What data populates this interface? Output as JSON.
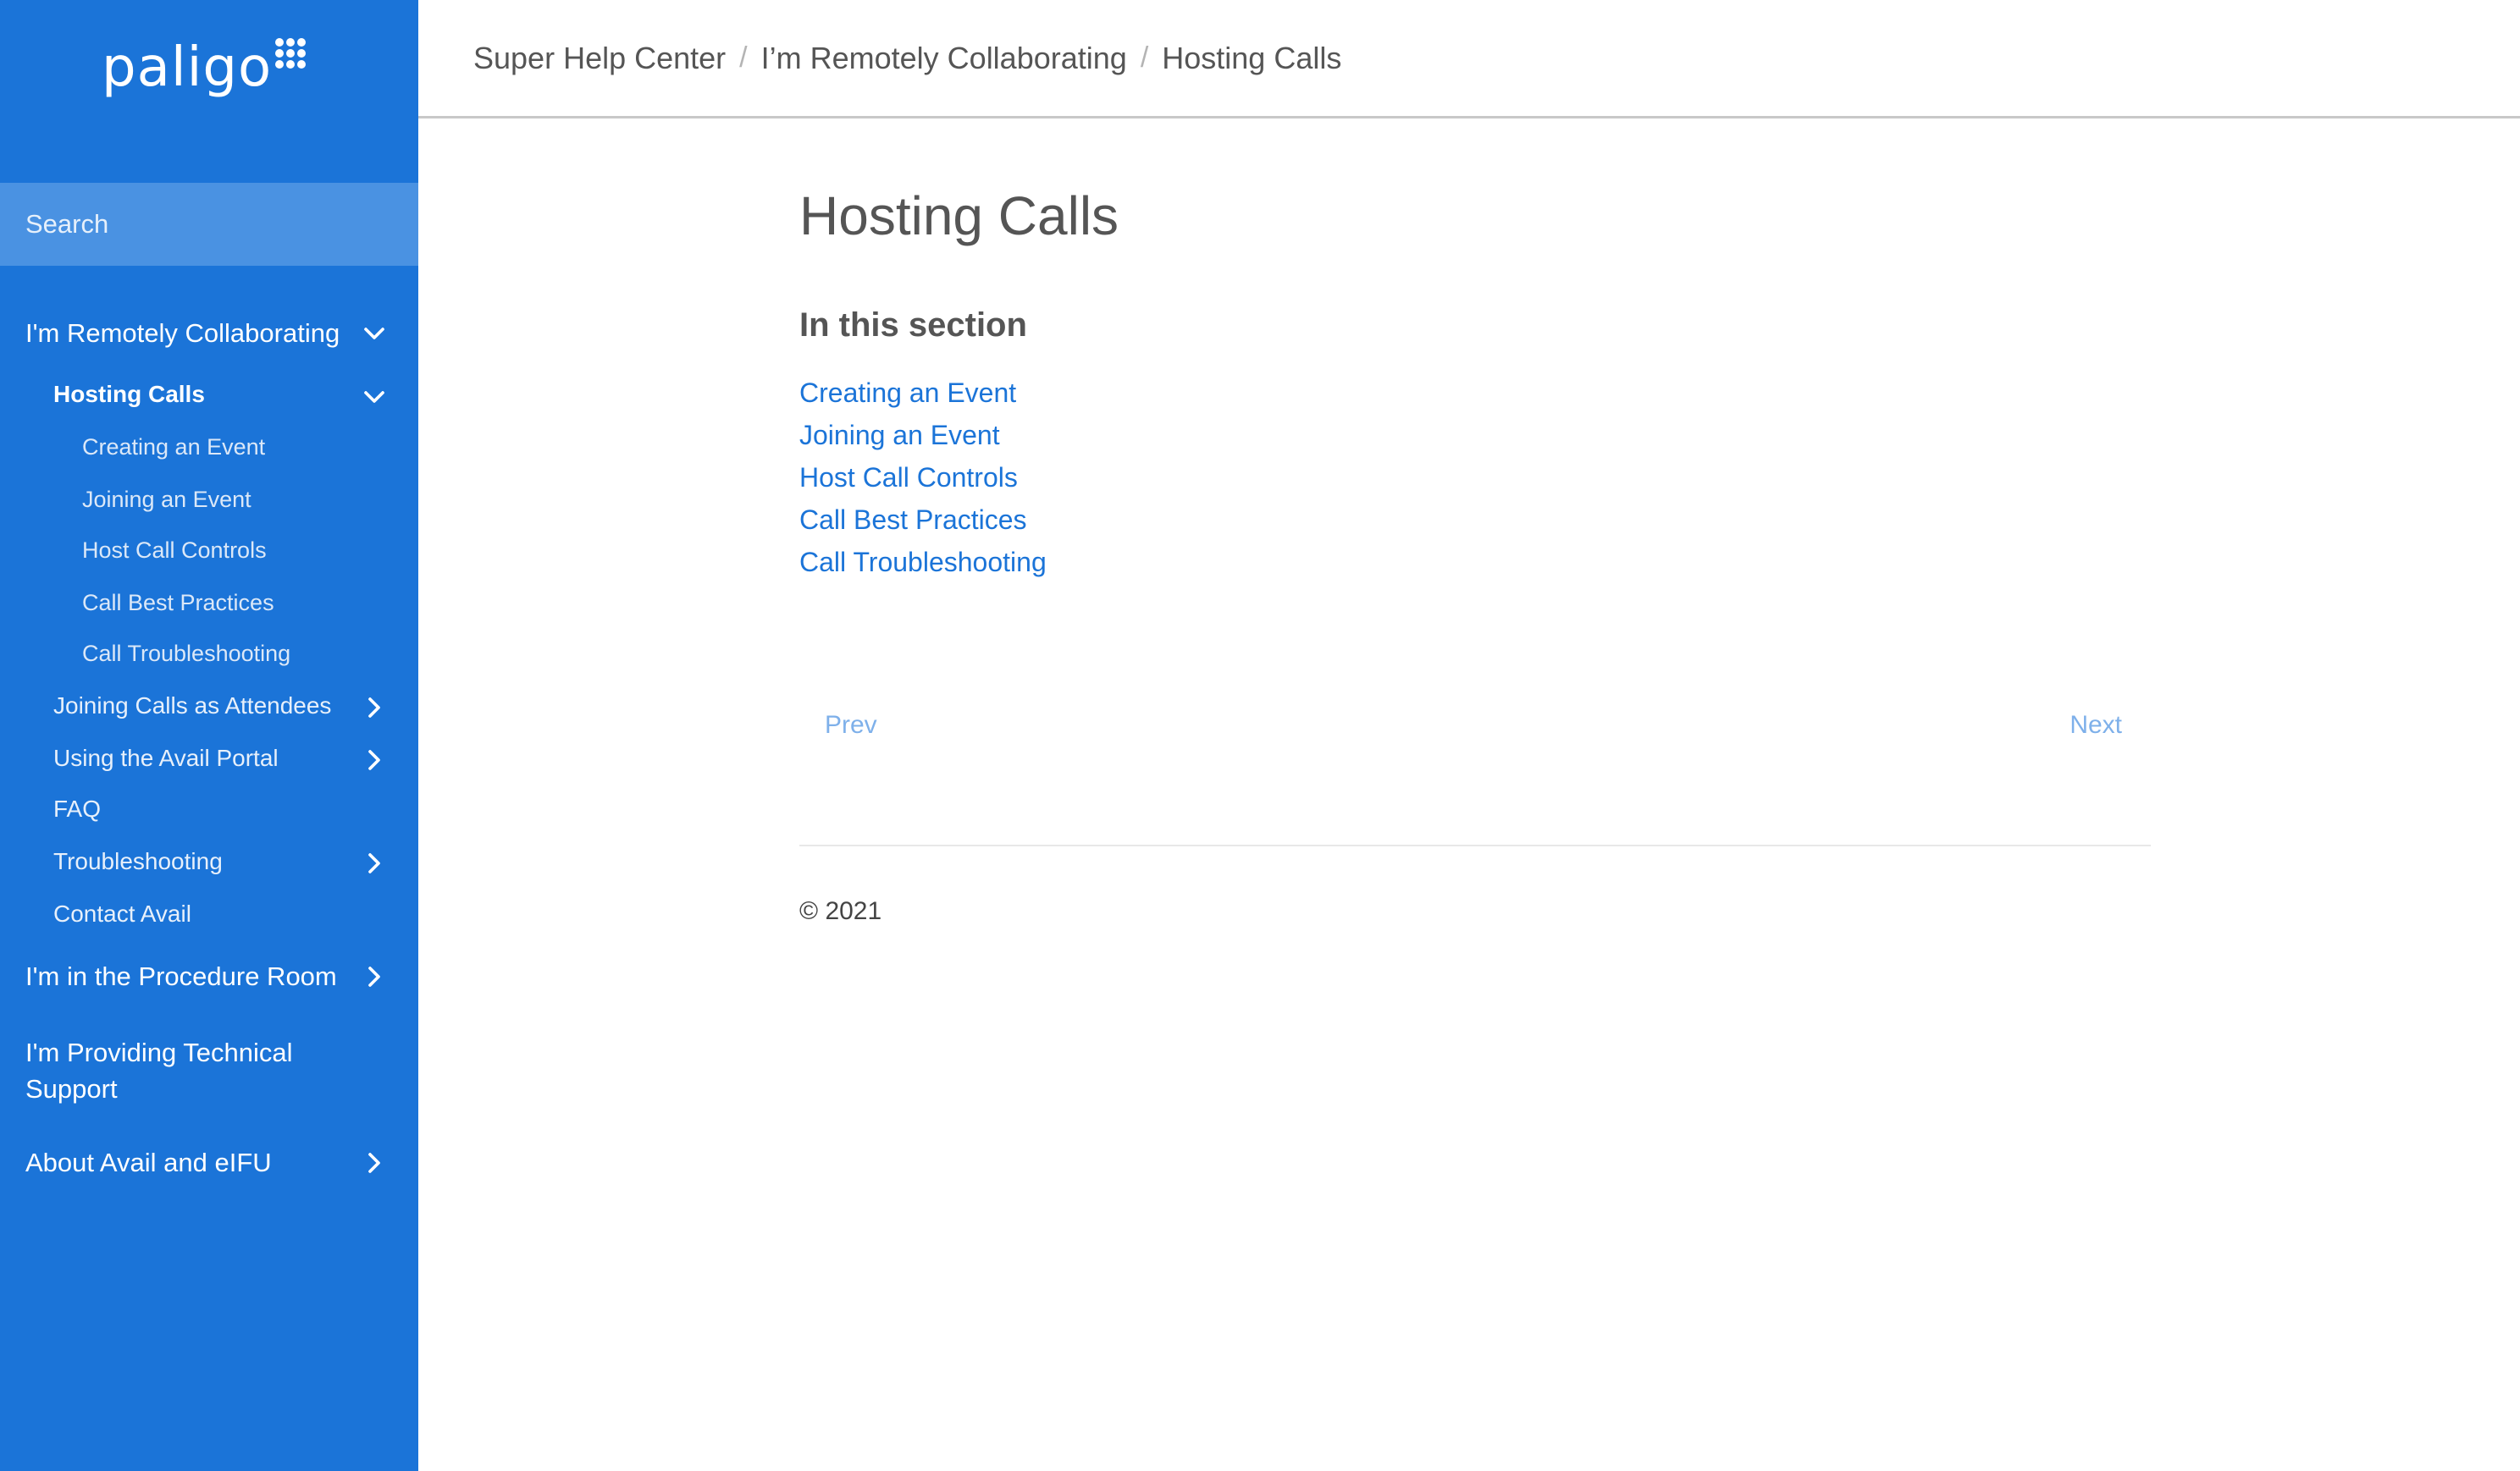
{
  "logo": {
    "text": "paligo"
  },
  "search": {
    "placeholder": "Search"
  },
  "sidebar": {
    "items": [
      {
        "label": "I'm Remotely Collaborating",
        "chevron": "chevron-down"
      },
      {
        "label": "Hosting Calls",
        "chevron": "chevron-down"
      },
      {
        "label": "Creating an Event"
      },
      {
        "label": "Joining an Event"
      },
      {
        "label": "Host Call Controls"
      },
      {
        "label": "Call Best Practices"
      },
      {
        "label": "Call Troubleshooting"
      },
      {
        "label": "Joining Calls as Attendees",
        "chevron": "chevron-right"
      },
      {
        "label": "Using the Avail Portal",
        "chevron": "chevron-right"
      },
      {
        "label": "FAQ"
      },
      {
        "label": "Troubleshooting",
        "chevron": "chevron-right"
      },
      {
        "label": "Contact Avail"
      },
      {
        "label": "I'm in the Procedure Room",
        "chevron": "chevron-right"
      },
      {
        "label": "I'm Providing Technical Support",
        "label_line2": "Support",
        "label_line1": "I'm Providing Technical"
      },
      {
        "label": "About Avail and eIFU",
        "chevron": "chevron-right"
      }
    ]
  },
  "breadcrumb": {
    "items": [
      "Super Help Center",
      "I’m Remotely Collaborating",
      "Hosting Calls"
    ],
    "separator": "/"
  },
  "main": {
    "title": "Hosting Calls",
    "section_heading": "In this section",
    "links": [
      "Creating an Event",
      "Joining an Event",
      "Host Call Controls",
      "Call Best Practices",
      "Call Troubleshooting"
    ],
    "prev_label": "Prev",
    "next_label": "Next",
    "copyright": "© 2021"
  },
  "colors": {
    "sidebar_bg": "#1b74d8",
    "search_bg": "#4a92e2",
    "link": "#1b74d8",
    "pager_link": "#7eb0ea"
  }
}
